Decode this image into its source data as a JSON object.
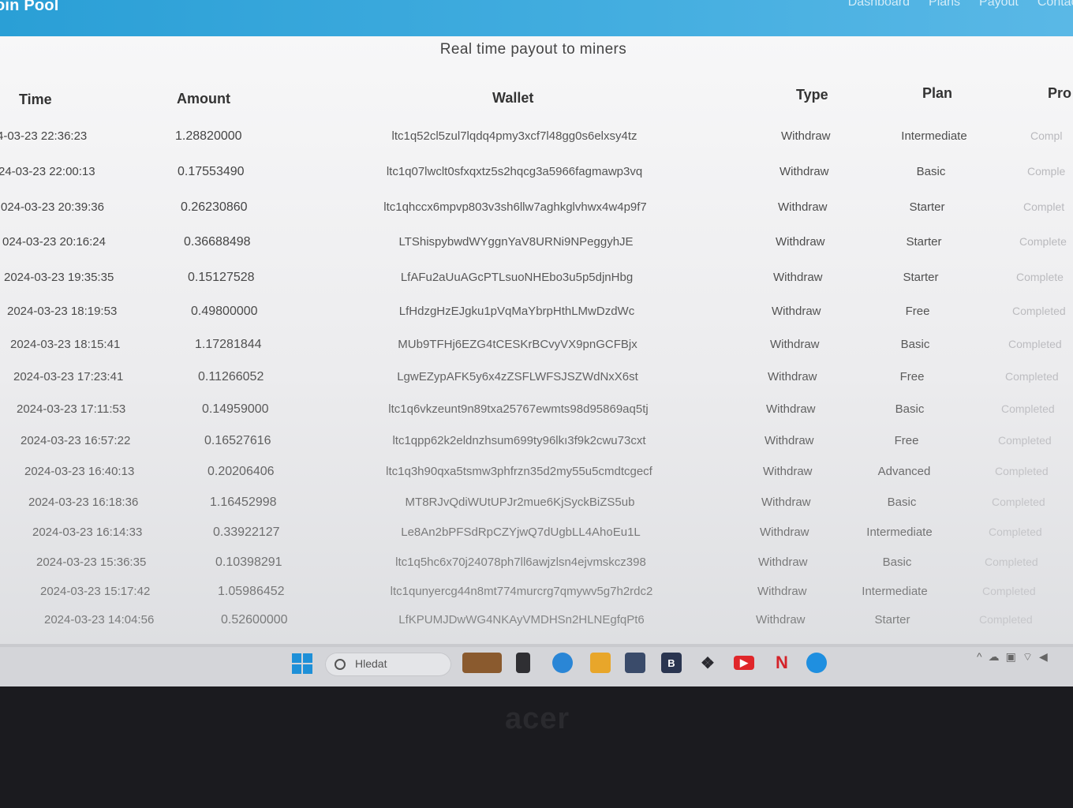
{
  "navbar": {
    "brand": "oin Pool",
    "links": [
      "Dashboard",
      "Plans",
      "Payout",
      "Contact"
    ]
  },
  "page": {
    "title": "Real time payout to miners"
  },
  "table": {
    "headers": [
      "Time",
      "Amount",
      "Wallet",
      "Type",
      "Plan",
      "Pro"
    ],
    "rows": [
      {
        "time": "4-03-23 22:36:23",
        "amount": "1.28820000",
        "wallet": "ltc1q52cl5zul7lqdq4pmy3xcf7l48gg0s6elxsy4tz",
        "type": "Withdraw",
        "plan": "Intermediate",
        "progress": "Compl"
      },
      {
        "time": "24-03-23 22:00:13",
        "amount": "0.17553490",
        "wallet": "ltc1q07lwclt0sfxqxtz5s2hqcg3a5966fagmawp3vq",
        "type": "Withdraw",
        "plan": "Basic",
        "progress": "Comple"
      },
      {
        "time": "024-03-23 20:39:36",
        "amount": "0.26230860",
        "wallet": "ltc1qhccx6mpvp803v3sh6llw7aghkglvhwx4w4p9f7",
        "type": "Withdraw",
        "plan": "Starter",
        "progress": "Complet"
      },
      {
        "time": "024-03-23 20:16:24",
        "amount": "0.36688498",
        "wallet": "LTShispybwdWYggnYaV8URNi9NPeggyhJE",
        "type": "Withdraw",
        "plan": "Starter",
        "progress": "Complete"
      },
      {
        "time": "2024-03-23 19:35:35",
        "amount": "0.15127528",
        "wallet": "LfAFu2aUuAGcPTLsuoNHEbo3u5p5djnHbg",
        "type": "Withdraw",
        "plan": "Starter",
        "progress": "Complete"
      },
      {
        "time": "2024-03-23 18:19:53",
        "amount": "0.49800000",
        "wallet": "LfHdzgHzEJgku1pVqMaYbrpHthLMwDzdWc",
        "type": "Withdraw",
        "plan": "Free",
        "progress": "Completed"
      },
      {
        "time": "2024-03-23 18:15:41",
        "amount": "1.17281844",
        "wallet": "MUb9TFHj6EZG4tCESKrBCvyVX9pnGCFBjx",
        "type": "Withdraw",
        "plan": "Basic",
        "progress": "Completed"
      },
      {
        "time": "2024-03-23 17:23:41",
        "amount": "0.11266052",
        "wallet": "LgwEZypAFK5y6x4zZSFLWFSJSZWdNxX6st",
        "type": "Withdraw",
        "plan": "Free",
        "progress": "Completed"
      },
      {
        "time": "2024-03-23 17:11:53",
        "amount": "0.14959000",
        "wallet": "ltc1q6vkzeunt9n89txa25767ewmts98d95869aq5tj",
        "type": "Withdraw",
        "plan": "Basic",
        "progress": "Completed"
      },
      {
        "time": "2024-03-23 16:57:22",
        "amount": "0.16527616",
        "wallet": "ltc1qpp62k2eldnzhsum699ty96lkı3f9k2cwu73cxt",
        "type": "Withdraw",
        "plan": "Free",
        "progress": "Completed"
      },
      {
        "time": "2024-03-23 16:40:13",
        "amount": "0.20206406",
        "wallet": "ltc1q3h90qxa5tsmw3phfrzn35d2my55u5cmdtcgecf",
        "type": "Withdraw",
        "plan": "Advanced",
        "progress": "Completed"
      },
      {
        "time": "2024-03-23 16:18:36",
        "amount": "1.16452998",
        "wallet": "MT8RJvQdiWUtUPJr2mue6KjSyckBiZS5ub",
        "type": "Withdraw",
        "plan": "Basic",
        "progress": "Completed"
      },
      {
        "time": "2024-03-23 16:14:33",
        "amount": "0.33922127",
        "wallet": "Le8An2bPFSdRpCZYjwQ7dUgbLL4AhoEu1L",
        "type": "Withdraw",
        "plan": "Intermediate",
        "progress": "Completed"
      },
      {
        "time": "2024-03-23 15:36:35",
        "amount": "0.10398291",
        "wallet": "ltc1q5hc6x70j24078ph7ll6awjzlsn4ejvmskcz398",
        "type": "Withdraw",
        "plan": "Basic",
        "progress": "Completed"
      },
      {
        "time": "2024-03-23 15:17:42",
        "amount": "1.05986452",
        "wallet": "ltc1qunyercg44n8mt774murcrg7qmywv5g7h2rdc2",
        "type": "Withdraw",
        "plan": "Intermediate",
        "progress": "Completed"
      },
      {
        "time": "2024-03-23 14:04:56",
        "amount": "0.52600000",
        "wallet": "LfKPUMJDwWG4NKAyVMDHSn2HLNEgfqPt6",
        "type": "Withdraw",
        "plan": "Starter",
        "progress": "Completed"
      }
    ]
  },
  "taskbar": {
    "search_label": "Hledat",
    "icons": [
      "windows-start-icon",
      "search-icon",
      "widget-icon",
      "task-view-icon",
      "teams-chat-icon",
      "file-explorer-icon",
      "calculator-icon",
      "bitwarden-icon",
      "dropbox-icon",
      "youtube-icon",
      "netflix-icon",
      "edge-icon"
    ],
    "tray_icons": [
      "chevron-up-icon",
      "cloud-icon",
      "app-tray-icon",
      "wifi-icon",
      "volume-icon"
    ]
  },
  "colors": {
    "navbar": "#2a9fd6",
    "page_bg": "#f2f2f3",
    "progress_text": "#b9b9bd",
    "taskbar": "#d4d5d9"
  },
  "device": {
    "brand_text": "acer"
  }
}
